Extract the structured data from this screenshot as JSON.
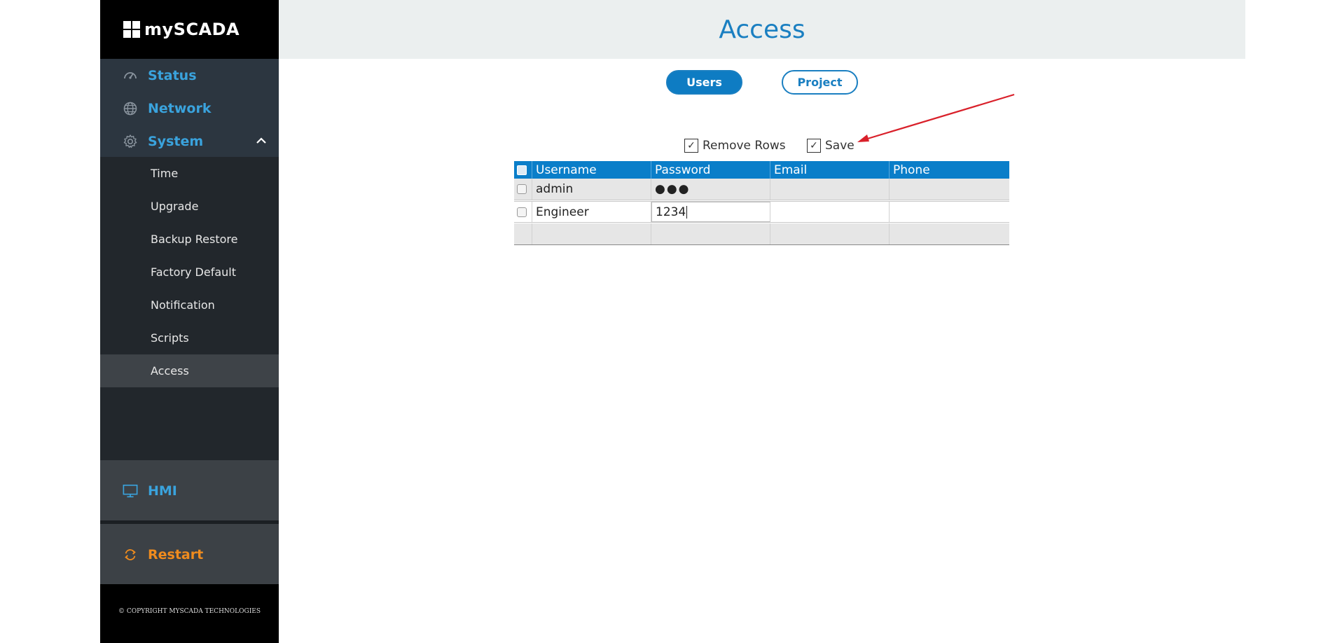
{
  "app": {
    "logo_text": "mySCADA"
  },
  "sidebar": {
    "main_items": [
      {
        "label": "Status",
        "icon": "gauge-icon"
      },
      {
        "label": "Network",
        "icon": "globe-icon"
      },
      {
        "label": "System",
        "icon": "gear-icon"
      }
    ],
    "system_subitems": [
      {
        "label": "Time"
      },
      {
        "label": "Upgrade"
      },
      {
        "label": "Backup Restore"
      },
      {
        "label": "Factory Default"
      },
      {
        "label": "Notification"
      },
      {
        "label": "Scripts"
      },
      {
        "label": "Access",
        "active": true
      }
    ],
    "hmi_label": "HMI",
    "restart_label": "Restart",
    "copyright": "© COPYRIGHT MYSCADA TECHNOLOGIES"
  },
  "header": {
    "title": "Access"
  },
  "tabs": {
    "users": "Users",
    "project": "Project"
  },
  "options": {
    "remove_rows": {
      "label": "Remove Rows",
      "checked": true
    },
    "save": {
      "label": "Save",
      "checked": true
    }
  },
  "table": {
    "headers": [
      "Username",
      "Password",
      "Email",
      "Phone"
    ],
    "rows": [
      {
        "username": "admin",
        "password": "●●●",
        "email": "",
        "phone": ""
      },
      {
        "username": "Engineer",
        "password": "1234",
        "email": "",
        "phone": ""
      }
    ]
  },
  "colors": {
    "accent": "#0e7cc3",
    "restart": "#f08c1e",
    "annotation_arrow": "#d9202a"
  }
}
